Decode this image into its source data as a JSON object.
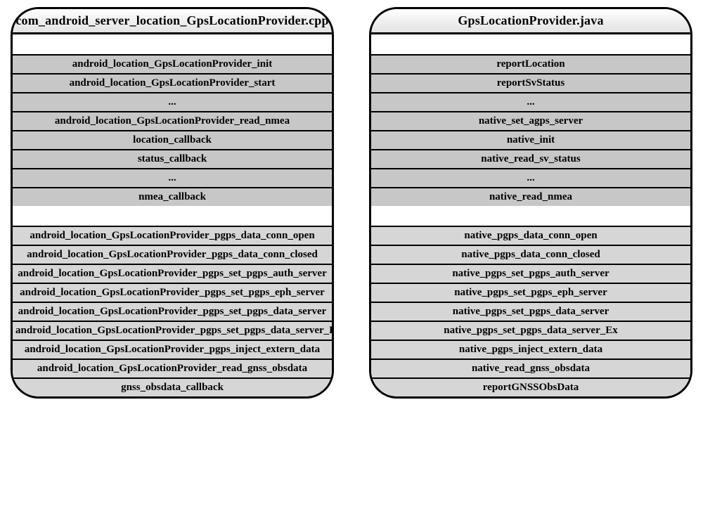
{
  "left": {
    "title": "com_android_server_location_GpsLocationProvider.cpp",
    "groupA": [
      "android_location_GpsLocationProvider_init",
      "android_location_GpsLocationProvider_start",
      "...",
      "android_location_GpsLocationProvider_read_nmea",
      "location_callback",
      "status_callback",
      "...",
      "nmea_callback"
    ],
    "groupB": [
      "android_location_GpsLocationProvider_pgps_data_conn_open",
      "android_location_GpsLocationProvider_pgps_data_conn_closed",
      "android_location_GpsLocationProvider_pgps_set_pgps_auth_server",
      "android_location_GpsLocationProvider_pgps_set_pgps_eph_server",
      "android_location_GpsLocationProvider_pgps_set_pgps_data_server",
      "android_location_GpsLocationProvider_pgps_set_pgps_data_server_Ex",
      "android_location_GpsLocationProvider_pgps_inject_extern_data",
      "android_location_GpsLocationProvider_read_gnss_obsdata",
      "gnss_obsdata_callback"
    ]
  },
  "right": {
    "title": "GpsLocationProvider.java",
    "groupA": [
      "reportLocation",
      "reportSvStatus",
      "...",
      "native_set_agps_server",
      "native_init",
      "native_read_sv_status",
      "...",
      "native_read_nmea"
    ],
    "groupB": [
      "native_pgps_data_conn_open",
      "native_pgps_data_conn_closed",
      "native_pgps_set_pgps_auth_server",
      "native_pgps_set_pgps_eph_server",
      "native_pgps_set_pgps_data_server",
      "native_pgps_set_pgps_data_server_Ex",
      "native_pgps_inject_extern_data",
      "native_read_gnss_obsdata",
      "reportGNSSObsData"
    ]
  }
}
